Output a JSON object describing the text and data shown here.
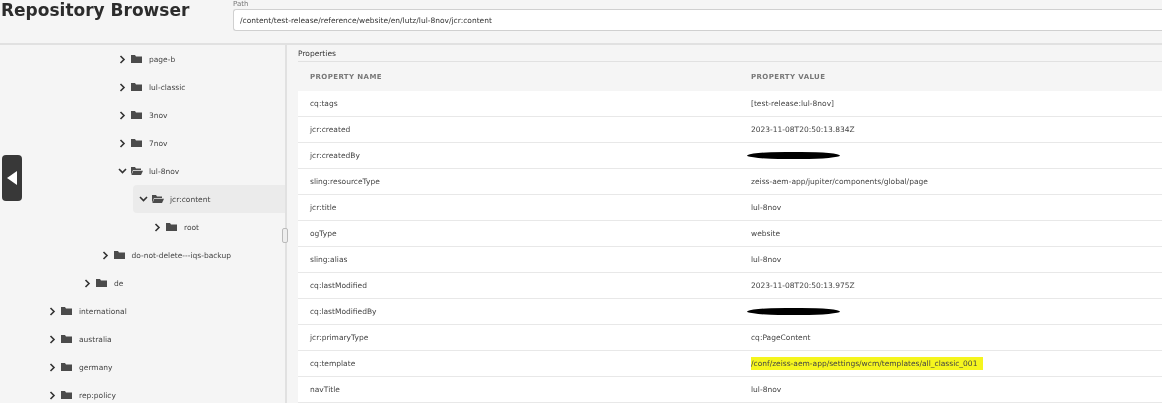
{
  "header": {
    "title": "Repository Browser",
    "path_label": "Path",
    "path_value": "/content/test-release/reference/website/en/lutz/lul-8nov/jcr:content"
  },
  "tree": [
    {
      "children": [
        {
          "children": [
            {
              "children": [
                {
                  "children": [
                    {
                      "label": "page-b",
                      "expanded": false,
                      "selected": false
                    },
                    {
                      "label": "lul-classic",
                      "expanded": false,
                      "selected": false
                    },
                    {
                      "label": "3nov",
                      "expanded": false,
                      "selected": false
                    },
                    {
                      "label": "7nov",
                      "expanded": false,
                      "selected": false
                    },
                    {
                      "label": "lul-8nov",
                      "expanded": true,
                      "selected": false,
                      "children": [
                        {
                          "label": "jcr:content",
                          "expanded": true,
                          "selected": true,
                          "children": [
                            {
                              "label": "root",
                              "expanded": false,
                              "selected": false
                            }
                          ]
                        }
                      ]
                    }
                  ]
                },
                {
                  "label": "do-not-delete---iqs-backup",
                  "expanded": false,
                  "selected": false
                }
              ]
            },
            {
              "label": "de",
              "expanded": false,
              "selected": false
            }
          ]
        }
      ]
    },
    {
      "label": "international",
      "expanded": false,
      "selected": false
    },
    {
      "label": "australia",
      "expanded": false,
      "selected": false
    },
    {
      "label": "germany",
      "expanded": false,
      "selected": false
    },
    {
      "label": "rep:policy",
      "expanded": false,
      "selected": false
    }
  ],
  "properties": {
    "title": "Properties",
    "columns": [
      "PROPERTY NAME",
      "PROPERTY VALUE"
    ],
    "rows": [
      {
        "name": "cq:tags",
        "value": "[test-release:lul-8nov]"
      },
      {
        "name": "jcr:created",
        "value": "2023-11-08T20:50:13.834Z"
      },
      {
        "name": "jcr:createdBy",
        "redacted": true
      },
      {
        "name": "sling:resourceType",
        "value": "zeiss-aem-app/jupiter/components/global/page"
      },
      {
        "name": "jcr:title",
        "value": "lul-8nov"
      },
      {
        "name": "ogType",
        "value": "website"
      },
      {
        "name": "sling:alias",
        "value": "lul-8nov"
      },
      {
        "name": "cq:lastModified",
        "value": "2023-11-08T20:50:13.975Z"
      },
      {
        "name": "cq:lastModifiedBy",
        "redacted": true
      },
      {
        "name": "jcr:primaryType",
        "value": "cq:PageContent"
      },
      {
        "name": "cq:template",
        "value": "/conf/zeiss-aem-app/settings/wcm/templates/all_classic_001",
        "highlighted": true
      },
      {
        "name": "navTitle",
        "value": "lul-8nov"
      }
    ]
  }
}
